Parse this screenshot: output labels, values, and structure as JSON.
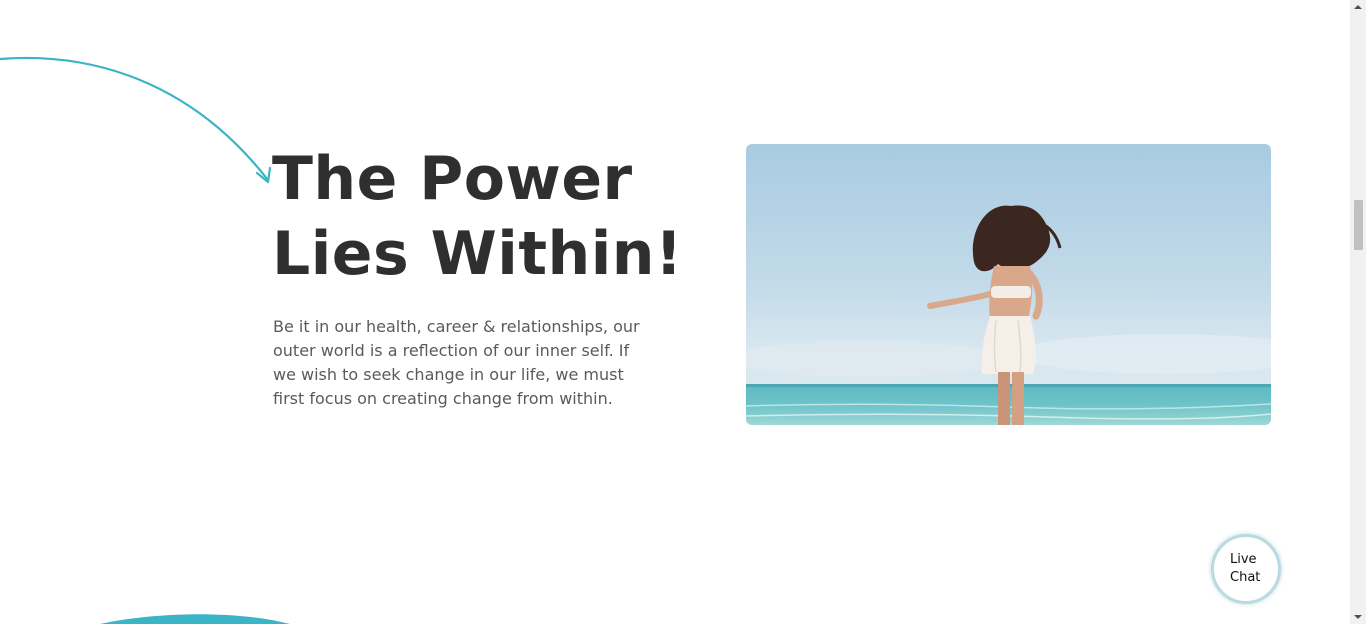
{
  "section": {
    "heading_line1": "The Power",
    "heading_line2": "Lies Within!",
    "body": "Be it in our health, career & relationships, our outer world is a reflection of our inner self. If we wish to seek change in our life, we must first focus on creating change from within."
  },
  "hero_image": {
    "alt": "Woman standing on a beach facing the ocean"
  },
  "live_chat": {
    "label": "Live Chat"
  },
  "colors": {
    "accent": "#3bb4c6",
    "heading": "#2f2f2f",
    "body_text": "#5a5a5a",
    "chat_ring": "#b9dbe0"
  },
  "icons": [
    "decorative-arrow-icon",
    "scroll-up-arrow-icon",
    "scroll-down-arrow-icon"
  ]
}
